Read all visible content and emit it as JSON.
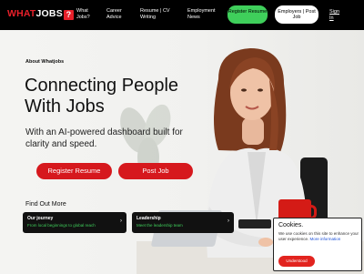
{
  "header": {
    "logo": {
      "what": "WHAT",
      "jobs": "JOBS",
      "mark": "?"
    },
    "nav": [
      {
        "label": "What\nJobs?"
      },
      {
        "label": "Career\nAdvice"
      },
      {
        "label": "Resume | CV\nWriting"
      },
      {
        "label": "Employment\nNews"
      }
    ],
    "register_label": "Register Resume",
    "employers_label": "Employers | Post Job",
    "signin_label": "Sign In"
  },
  "hero": {
    "about": "About Whatjobs",
    "title": "Connecting People With Jobs",
    "subtitle": "With an AI-powered dashboard built for clarity and speed.",
    "register_button": "Register Resume",
    "post_button": "Post Job"
  },
  "find_out": {
    "heading": "Find Out More",
    "cards": [
      {
        "title": "Our journey",
        "subtitle": "From local beginnings to global reach",
        "arrow": "›"
      },
      {
        "title": "Leadership",
        "subtitle": "Meet the leadership team",
        "arrow": "›"
      }
    ]
  },
  "cookie": {
    "title": "Cookies.",
    "text": "We use cookies on this site to enhance your user experience.",
    "more": "More information",
    "button": "Understood"
  },
  "colors": {
    "brand_red": "#d6181d",
    "register_green": "#3fcf5b",
    "header_bg": "#000000"
  }
}
